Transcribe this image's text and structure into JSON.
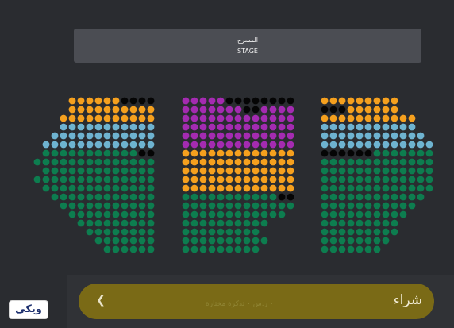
{
  "stage": {
    "label_ar": "المسرح",
    "label_en": "STAGE"
  },
  "buy": {
    "label": "شراء",
    "subtext": "٠ ر.س ٠ تذكرة مختارة"
  },
  "logo": {
    "text": "ويكي"
  },
  "colors": {
    "background": "#2a2c30",
    "stage": "#4b4d53",
    "orange": "#f5a01e",
    "purple": "#a42bb1",
    "blue": "#6eb3d0",
    "green": "#0d7d4f",
    "black": "#050505",
    "buy_button": "#7a6a16"
  },
  "icons": {
    "chevron": "chevron-left-icon"
  },
  "seat_legend": {
    "O": "orange",
    "P": "purple",
    "B": "blue",
    "G": "green",
    "K": "black"
  },
  "seat_sections": {
    "left": [
      "OOOOOOKKKK",
      "OOOOOOOOOO",
      "OOOOOOOOOOO",
      "BBBBBBBBBBB",
      "BBBBBBBBBBBB",
      "BBBBBBBBBBBBB",
      "GGGGGGGGGGGKK",
      "GGGGGGGGGGGGGG",
      "GGGGGGGGGGGGG",
      "GGGGGGGGGGGGGG",
      "GGGGGGGGGGGGG",
      "GGGGGGGGGGGG",
      "GGGGGGGGGGG",
      "GGGGGGGGGG",
      "GGGGGGGGG",
      "GGGGGGGG",
      "GGGGGGG",
      "GGGGGG"
    ],
    "center": [
      "PPPPPKKKKKKKK",
      "PPPPPPPKKPPPP",
      "PPPPPPPPPPPPP",
      "PPPPPPPPPPPPP",
      "PPPPPPPPPPPPP",
      "PPPPPPPPPPPPP",
      "OOOOOOOOOOOOO",
      "OOOOOOOOOOOOO",
      "OOOOOOOOOOOOO",
      "OOOOOOOOOOOOO",
      "OOOOOOOOOOOOO",
      "GGGGGGGGGGGKK",
      "GGGGGGGGGGGGG",
      "GGGGGGGGGGGG",
      "GGGGGGGGGG",
      "GGGGGGGGG",
      "GGGGGGGGGG",
      "GGGGGGGGG"
    ],
    "right": [
      "OOOOOOOOO",
      "KKKOOOOOO",
      "OOOOOOOOOOO",
      "BBBBBBBBBBB",
      "BBBBBBBBBBBB",
      "BBBBBBBBBBBBB",
      "KKKKKKGGGGGGG",
      "GGGGGGGGGGGGG",
      "GGGGGGGGGGGGG",
      "GGGGGGGGGGGGG",
      "GGGGGGGGGGGGG",
      "GGGGGGGGGGGG",
      "GGGGGGGGGGG",
      "GGGGGGGGGG",
      "GGGGGGGGG",
      "GGGGGGGGG",
      "GGGGGGGG",
      "GGGGGGG"
    ]
  }
}
